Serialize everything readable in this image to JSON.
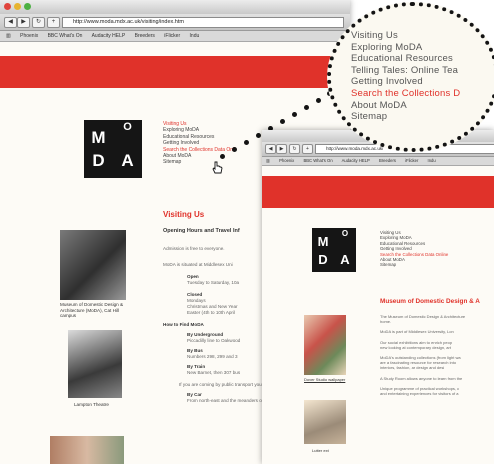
{
  "back_window": {
    "url": "http://www.moda.mdx.ac.uk/visiting/index.htm",
    "bookmarks": [
      "Phoenix",
      "BBC What's On",
      "Audacity HELP",
      "Breeders",
      "iFlicker",
      "Indu"
    ],
    "logo_letters": [
      "M",
      "O",
      "D",
      "A"
    ],
    "nav": [
      "Visiting Us",
      "Exploring MoDA",
      "Educational Resources",
      "Getting Involved",
      "Search the Collections Data Onli",
      "About MoDA",
      "Sitemap"
    ],
    "nav_highlight_index": 4,
    "heading": "Visiting Us",
    "subheading": "Opening Hours and Travel Inf",
    "lines": [
      "Admission is free to everyone.",
      "MoDA is situated at Middlesex Uni",
      "Open",
      "Tuesday to Saturday, 10a",
      "Closed",
      "Mondays",
      "Christmas and New Year",
      "Easter (4th to 10th April",
      "How to Find MoDA",
      "By Underground",
      "Piccadilly line to Oakwood",
      "By Bus",
      "Numbers 298, 299 and 3",
      "By Train",
      "New Barnet, then 307 bus",
      "If you are coming by public transport you may",
      "By Car",
      "From north-east and the meanders of 11 7 a"
    ],
    "captions": [
      "Museum of Domestic Design & Architecture (MoDA), Cat Hill campus",
      "Lampton Theatre"
    ]
  },
  "front_window": {
    "url": "http://www.moda.mdx.ac.uk/",
    "bookmarks": [
      "Phoenix",
      "BBC What's On",
      "Audacity HELP",
      "Breeders",
      "iFlicker",
      "Indu"
    ],
    "logo_letters": [
      "M",
      "O",
      "D",
      "A"
    ],
    "nav": [
      "Visiting Us",
      "Exploring MoDA",
      "Educational Resources",
      "Getting Involved",
      "Search the Collections Data Online",
      "About MoDA",
      "Sitemap"
    ],
    "nav_highlight_index": 4,
    "heading": "Museum of Domestic Design & A",
    "lines": [
      "The Museum of Domestic Design & Architecture",
      "home.",
      "MoDA is part of Middlesex University, Lon",
      "Our social exhibitions aim to enrich peop",
      "new looking at contemporary design, art",
      "MoDA's outstanding collections (from light wa",
      "are a fascinating resource for research into",
      "interiors, fashion, ar design and desi",
      "A Study Room allows anyone to learn from the",
      "Unique programme of practical workshops, c",
      "and entertaining experiences for visitors of a"
    ],
    "captions": [
      "Dover Studio wallpaper",
      "Lutter ext"
    ]
  },
  "magnifier": {
    "nav": [
      "Visiting Us",
      "Exploring MoDA",
      "Educational Resources",
      "Telling Tales: Online Tea",
      "Getting Involved",
      "Search the Collections D",
      "About MoDA",
      "Sitemap"
    ],
    "nav_highlight_index": 5
  },
  "colors": {
    "accent_red": "#e0322a",
    "logo_bg": "#151515",
    "page_bg": "#fdfbf6"
  }
}
